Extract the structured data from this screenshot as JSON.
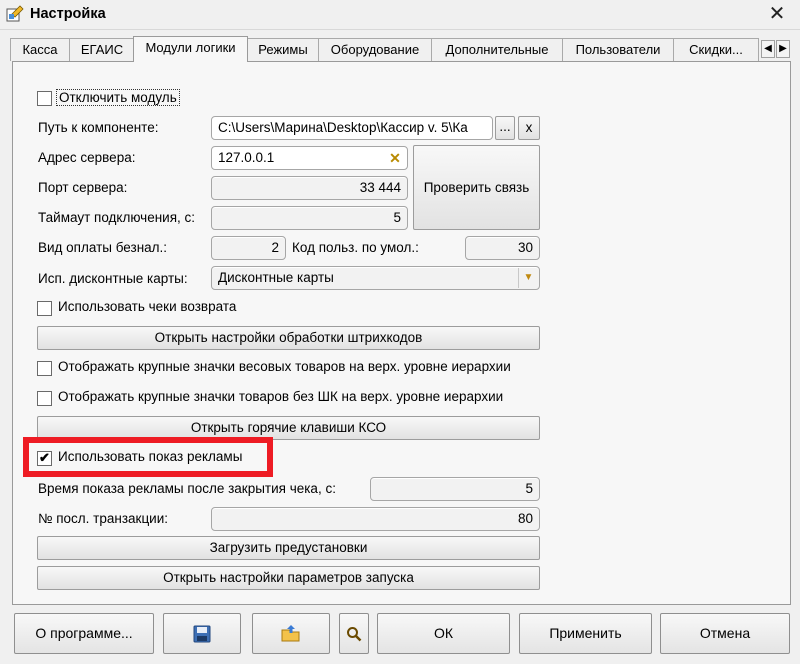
{
  "window": {
    "title": "Настройка",
    "close_glyph": "✕"
  },
  "tabs": [
    {
      "label": "Касса"
    },
    {
      "label": "ЕГАИС"
    },
    {
      "label": "Модули логики"
    },
    {
      "label": "Режимы"
    },
    {
      "label": "Оборудование"
    },
    {
      "label": "Дополнительные"
    },
    {
      "label": "Пользователи"
    },
    {
      "label": "Скидки..."
    }
  ],
  "tab_nav": {
    "prev": "◀",
    "next": "▶"
  },
  "form": {
    "disable_module": {
      "label": "Отключить модуль",
      "checked": false
    },
    "component_path": {
      "label": "Путь к компоненте:",
      "value": "C:\\Users\\Марина\\Desktop\\Кассир v. 5\\Ка",
      "browse_label": "...",
      "clear_label": "x"
    },
    "server_address": {
      "label": "Адрес сервера:",
      "value": "127.0.0.1",
      "clear_glyph": "✕"
    },
    "server_port": {
      "label": "Порт сервера:",
      "value": "33 444"
    },
    "timeout": {
      "label": "Таймаут подключения, с:",
      "value": "5"
    },
    "check_connection_label": "Проверить связь",
    "payment_type": {
      "label": "Вид оплаты безнал.:",
      "value": "2"
    },
    "default_user_code": {
      "label": "Код польз. по умол.:",
      "value": "30"
    },
    "discount_cards": {
      "label": "Исп. дисконтные карты:",
      "value": "Дисконтные карты",
      "dropdown_glyph": "▼"
    },
    "use_return_checks": {
      "label": "Использовать чеки возврата",
      "checked": false
    },
    "barcode_settings_label": "Открыть настройки обработки штрихкодов",
    "big_weight_icons": {
      "label": "Отображать крупные значки весовых товаров на верх. уровне иерархии",
      "checked": false
    },
    "big_nobarcode_icons": {
      "label": "Отображать крупные значки товаров без ШК на верх. уровне иерархии",
      "checked": false
    },
    "hotkeys_label": "Открыть горячие клавиши КСО",
    "use_ads": {
      "label": "Использовать показ рекламы",
      "checked": true,
      "check_glyph": "✔"
    },
    "ad_time": {
      "label": "Время показа рекламы после закрытия чека, с:",
      "value": "5"
    },
    "last_transaction": {
      "label": "№ посл. транзакции:",
      "value": "80"
    },
    "load_presets_label": "Загрузить предустановки",
    "launch_settings_label": "Открыть настройки параметров запуска"
  },
  "footer": {
    "about_label": "О программе...",
    "save_icon": "floppy-disk-icon",
    "open_icon": "folder-open-icon",
    "search_icon": "magnifier-icon",
    "ok_label": "ОК",
    "apply_label": "Применить",
    "cancel_label": "Отмена"
  },
  "colors": {
    "highlight": "#ee1c24",
    "accent_dropdown": "#c08a10"
  }
}
